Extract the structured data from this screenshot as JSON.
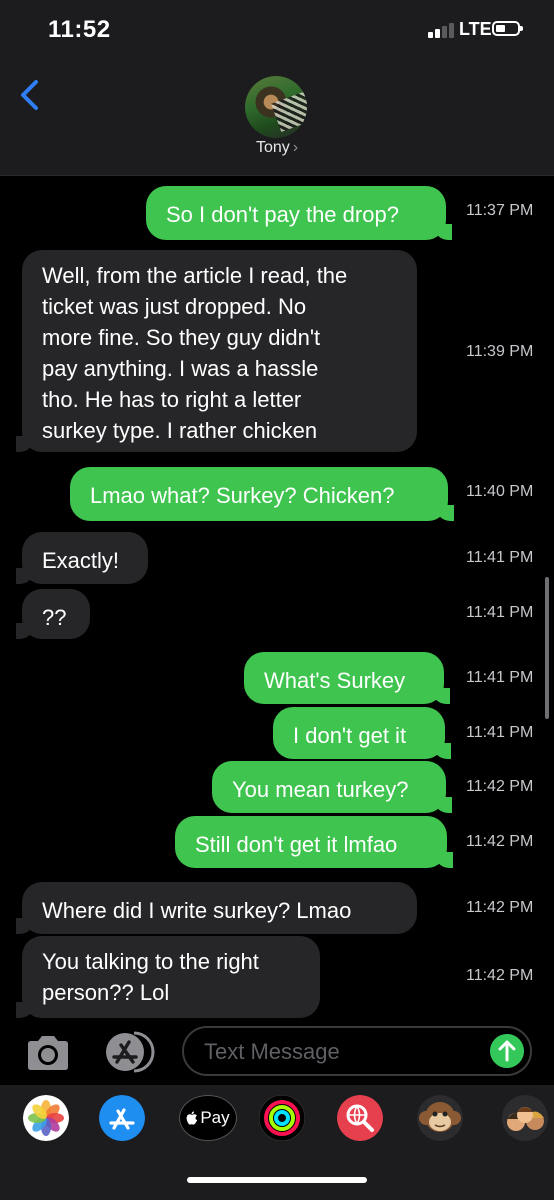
{
  "status_bar": {
    "time": "11:52",
    "network": "LTE"
  },
  "header": {
    "contact_name": "Tony",
    "chevron": "›"
  },
  "colors": {
    "sent_bubble": "#3fc54f",
    "received_bubble": "#262628",
    "header_bg": "#1c1c1e",
    "accent_blue": "#2f7ef6"
  },
  "messages": [
    {
      "direction": "sent",
      "lines": [
        "So I don't pay the drop?"
      ],
      "time": "11:37 PM"
    },
    {
      "direction": "received",
      "lines": [
        "Well, from the article I read, the",
        "ticket was just dropped. No",
        "more fine. So they guy didn't",
        "pay anything. I was a hassle",
        "tho. He has to right a letter",
        "surkey type. I rather chicken"
      ],
      "time": "11:39 PM"
    },
    {
      "direction": "sent",
      "lines": [
        "Lmao what? Surkey? Chicken?"
      ],
      "time": "11:40 PM"
    },
    {
      "direction": "received",
      "lines": [
        "Exactly!"
      ],
      "time": "11:41 PM"
    },
    {
      "direction": "received",
      "lines": [
        "??"
      ],
      "time": "11:41 PM"
    },
    {
      "direction": "sent",
      "lines": [
        "What's Surkey"
      ],
      "time": "11:41 PM"
    },
    {
      "direction": "sent",
      "lines": [
        "I don't get it"
      ],
      "time": "11:41 PM"
    },
    {
      "direction": "sent",
      "lines": [
        "You mean turkey?"
      ],
      "time": "11:42 PM"
    },
    {
      "direction": "sent",
      "lines": [
        "Still don't get it lmfao"
      ],
      "time": "11:42 PM"
    },
    {
      "direction": "received",
      "lines": [
        "Where did I write surkey? Lmao"
      ],
      "time": "11:42 PM"
    },
    {
      "direction": "received",
      "lines": [
        "You talking to the right",
        "person?? Lol"
      ],
      "time": "11:42 PM"
    }
  ],
  "input": {
    "placeholder": "Text Message"
  },
  "app_drawer": {
    "apps": [
      {
        "name": "photos-app-icon"
      },
      {
        "name": "app-store-icon"
      },
      {
        "name": "apple-pay-icon",
        "label": "Pay"
      },
      {
        "name": "activity-icon"
      },
      {
        "name": "web-search-icon"
      },
      {
        "name": "animoji-monkey-icon"
      },
      {
        "name": "memoji-icon"
      }
    ]
  }
}
